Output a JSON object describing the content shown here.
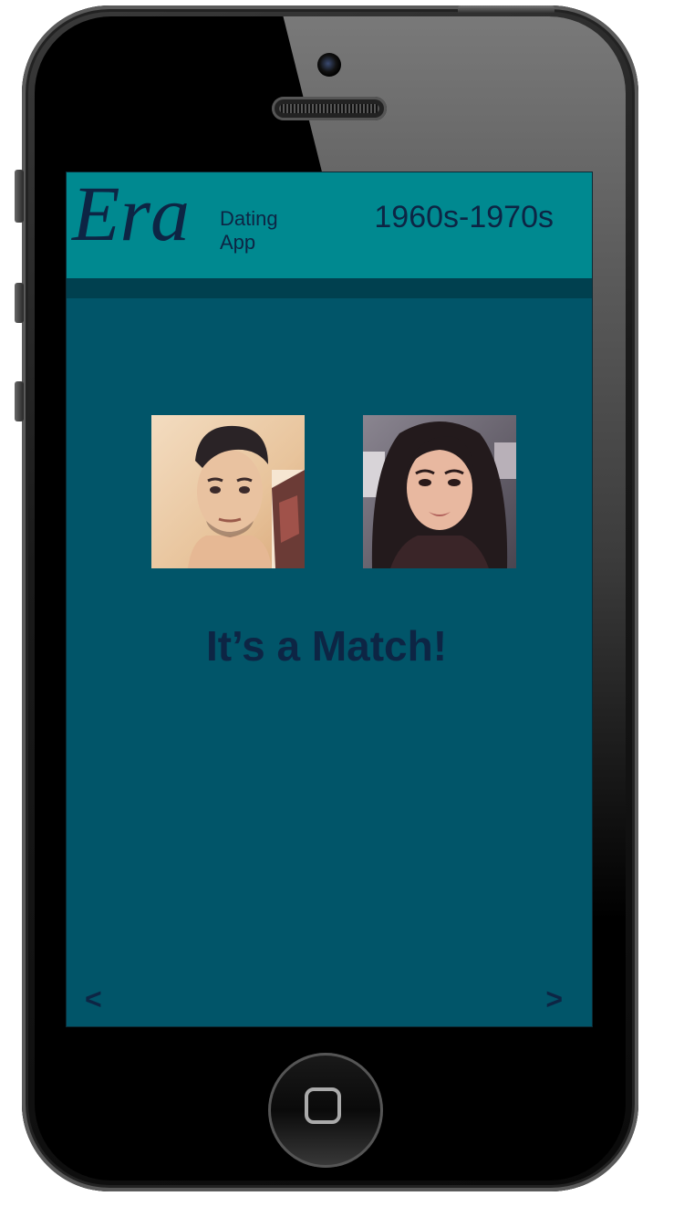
{
  "header": {
    "logo": "Era",
    "logo_sub_line1": "Dating",
    "logo_sub_line2": "App",
    "era_range": "1960s-1970s"
  },
  "match": {
    "title": "It’s a Match!",
    "photos": [
      {
        "subject": "man-selfie"
      },
      {
        "subject": "woman-selfie"
      }
    ]
  },
  "nav": {
    "prev_label": "<",
    "next_label": ">"
  },
  "colors": {
    "header_bg": "#008990",
    "screen_bg": "#015569",
    "text": "#0d2544"
  }
}
